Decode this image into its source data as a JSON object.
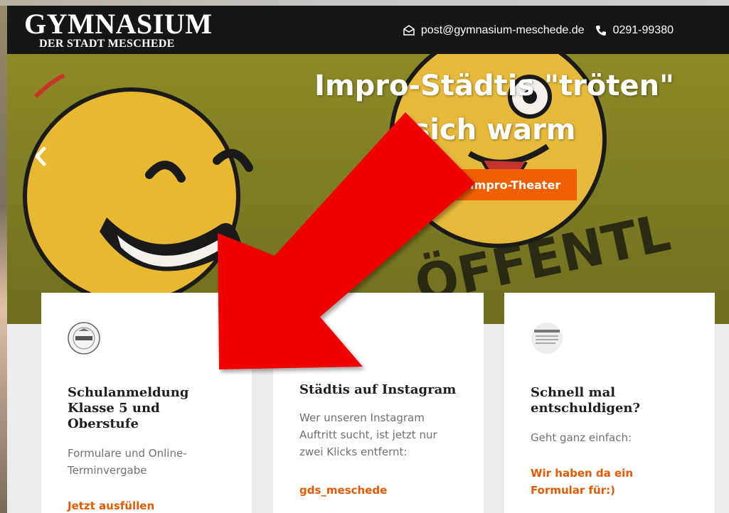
{
  "header": {
    "logo_main": "GYMNASIUM",
    "logo_sub": "DER STADT MESCHEDE",
    "email": "post@gymnasium-meschede.de",
    "phone": "0291-99380",
    "email_icon": "mail-icon",
    "phone_icon": "phone-icon"
  },
  "hero": {
    "title": "Impro-Städtis \"tröten\" sich warm",
    "button_label": "Impro-Theater",
    "prev_icon": "chevron-left-icon",
    "accent_color": "#f06000"
  },
  "cards": [
    {
      "title": "Schulanmeldung Klasse 5 und Oberstufe",
      "text": "Formulare und Online-Terminvergabe",
      "link": "Jetzt ausfüllen",
      "icon": "school-seal-icon"
    },
    {
      "title": "Städtis auf Instagram",
      "text": "Wer unseren Instagram Auftritt sucht, ist jetzt nur zwei Klicks entfernt:",
      "link": "gds_meschede",
      "icon": "instagram-icon"
    },
    {
      "title": "Schnell mal entschuldigen?",
      "text": "Geht ganz einfach:",
      "link": "Wir haben da ein Formular für:)",
      "icon": "document-stamp-icon"
    }
  ],
  "overlay": {
    "arrow_color": "#f20000",
    "arrow_icon": "arrow-down-left-icon"
  }
}
